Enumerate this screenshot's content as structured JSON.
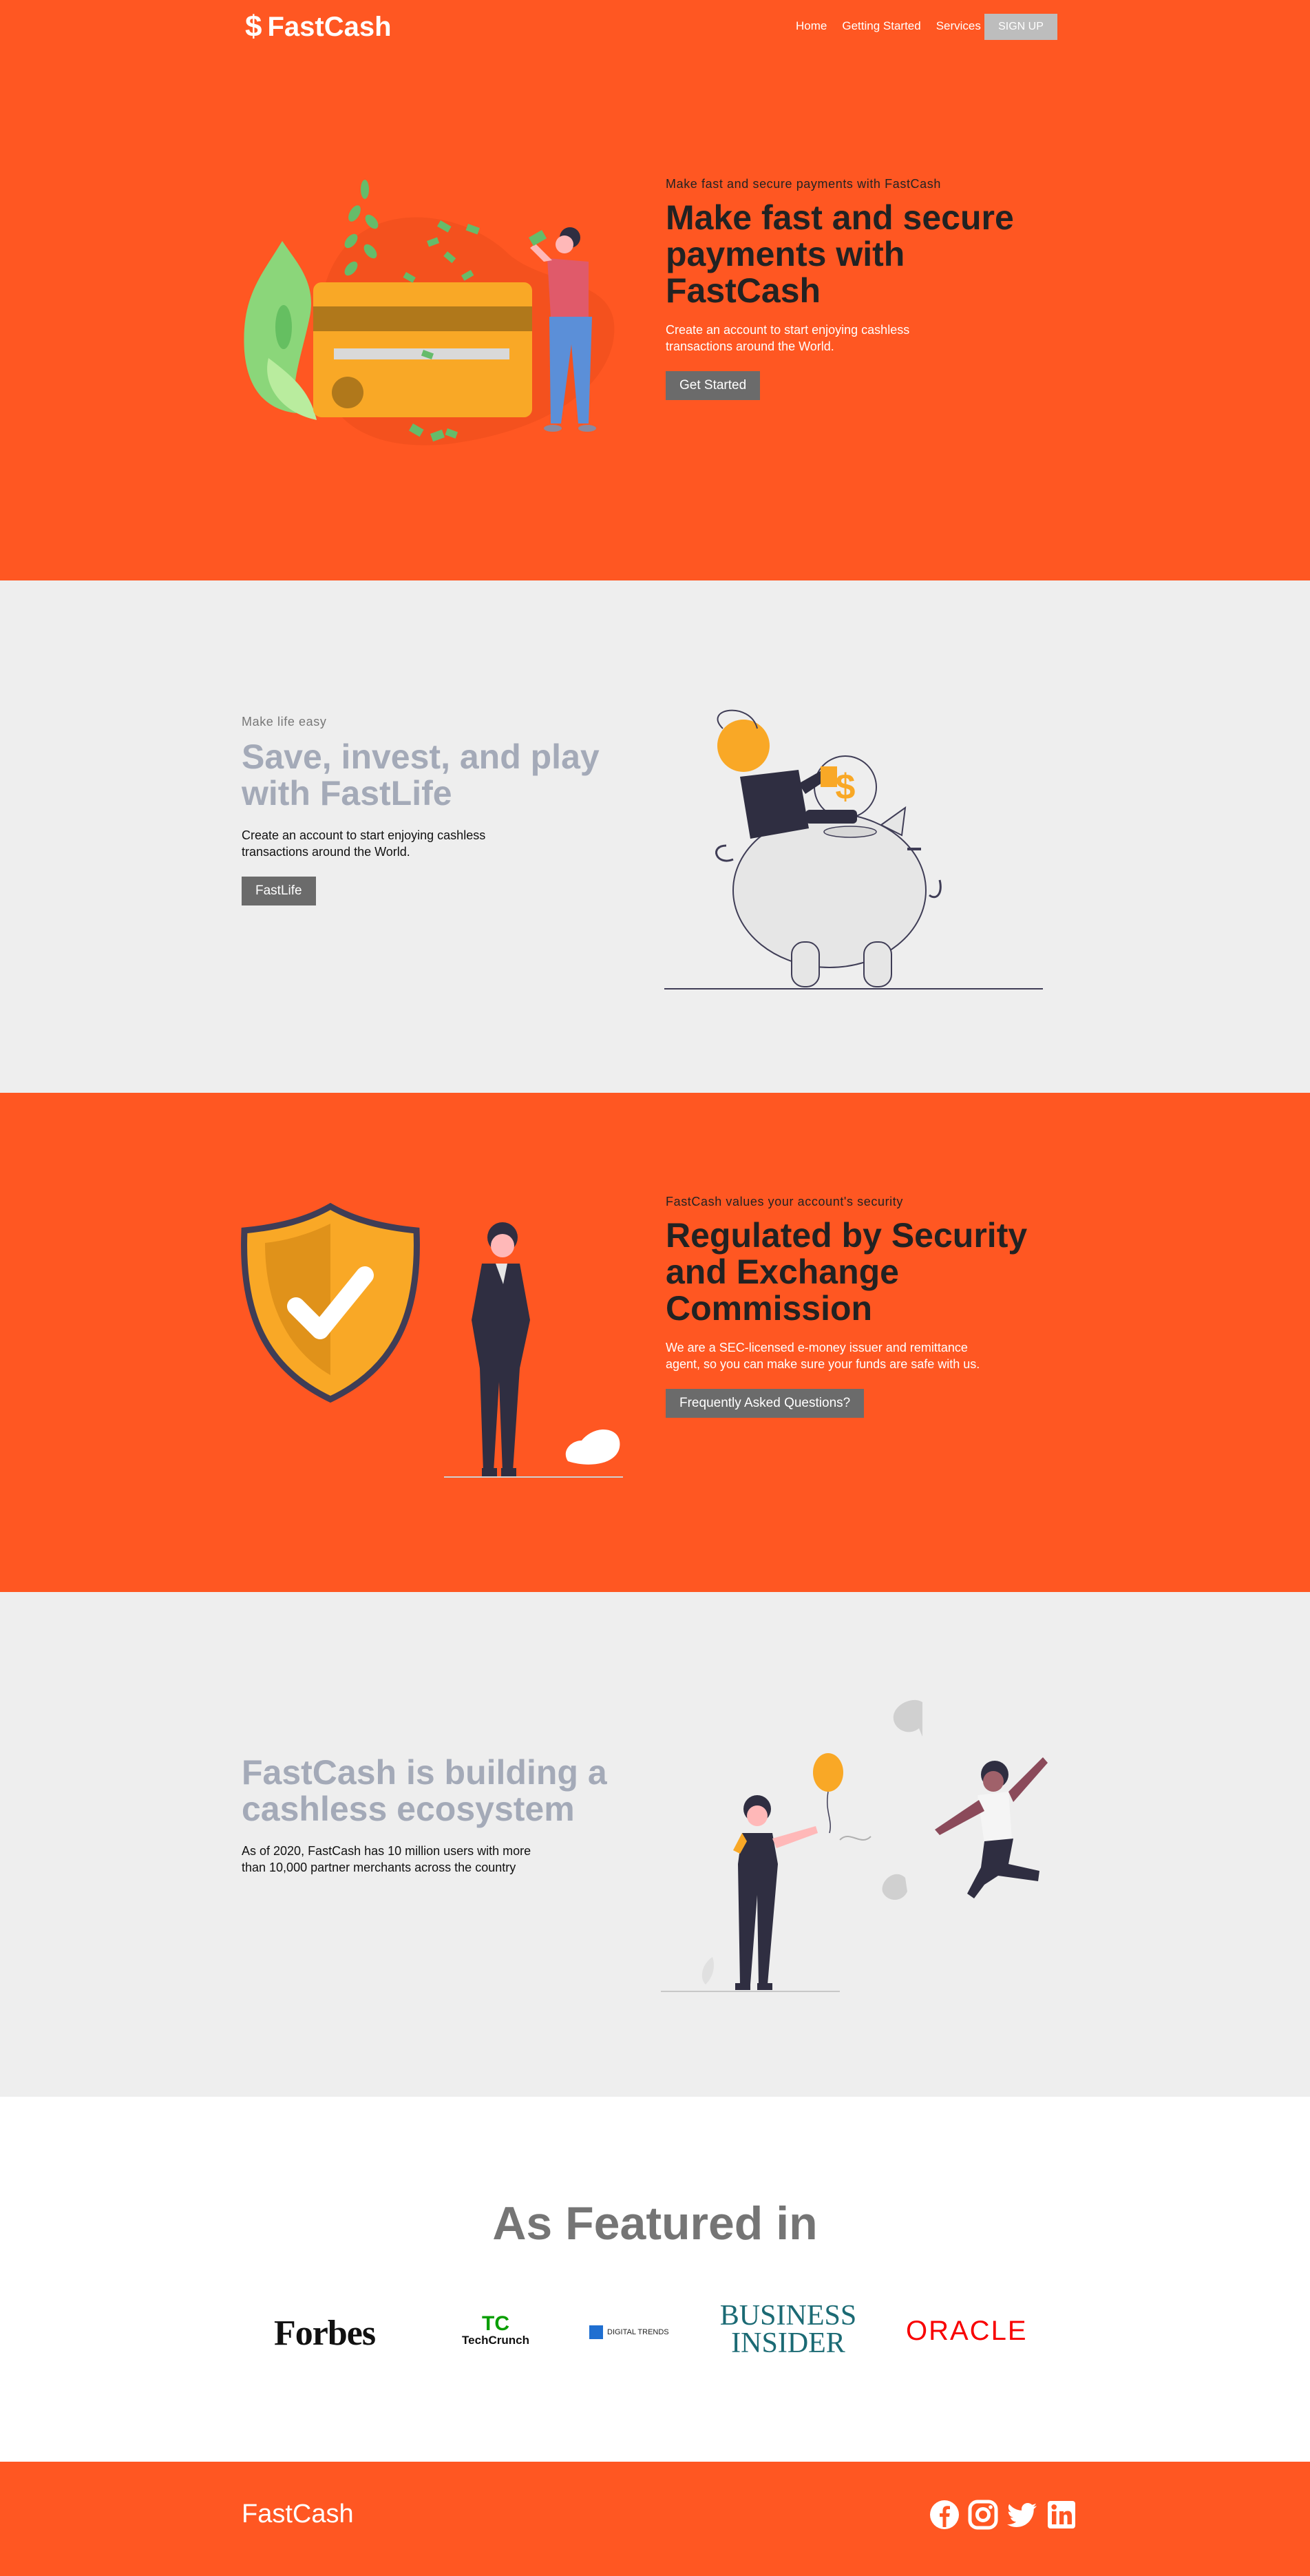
{
  "nav": {
    "brand": "FastCash",
    "brand_icon": "dollar-icon",
    "links": [
      "Home",
      "Getting Started",
      "Services"
    ],
    "signup_label": "SIGN UP"
  },
  "hero": {
    "eyebrow": "Make fast and secure payments with FastCash",
    "title": "Make fast and secure payments with FastCash",
    "body": "Create an account to start enjoying cashless transactions around the World.",
    "button": "Get Started"
  },
  "fastlife": {
    "eyebrow": "Make life easy",
    "title": "Save, invest, and play with FastLife",
    "body": "Create an account to start enjoying cashless transactions around the World.",
    "button": "FastLife"
  },
  "security": {
    "eyebrow": "FastCash values your account's security",
    "title": "Regulated by Security and Exchange Commission",
    "body": "We are a SEC-licensed e-money issuer and remittance agent, so you can make sure your funds are safe with us.",
    "button": "Frequently Asked Questions?"
  },
  "ecosystem": {
    "title": "FastCash is building a cashless ecosystem",
    "body": "As of 2020, FastCash has 10 million users with more than 10,000 partner merchants across the country"
  },
  "featured": {
    "title": "As Featured in",
    "logos": [
      "Forbes",
      "TechCrunch",
      "DIGITAL TRENDS",
      "BUSINESS INSIDER",
      "ORACLE"
    ]
  },
  "footer": {
    "brand": "FastCash",
    "social_icons": [
      "facebook-icon",
      "instagram-icon",
      "twitter-icon",
      "linkedin-icon"
    ]
  },
  "colors": {
    "primary": "#ff5722",
    "section_grey": "#eeeeee",
    "button_grey": "#6b6b6b",
    "accent_yellow": "#f9a826"
  }
}
